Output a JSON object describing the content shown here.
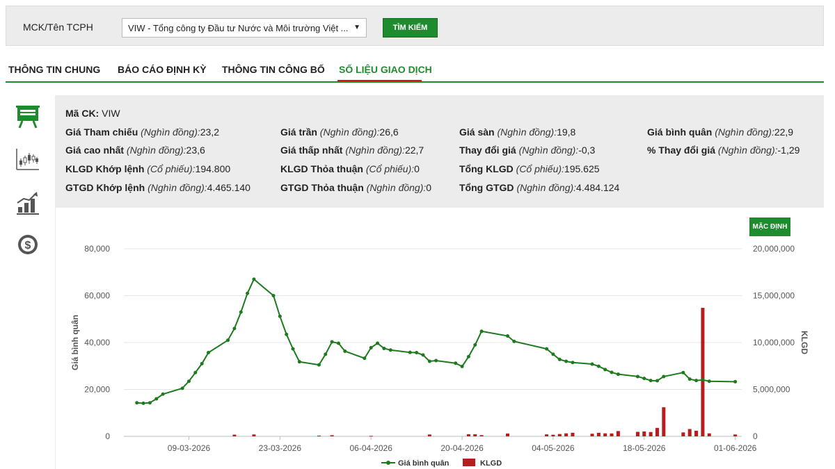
{
  "search": {
    "label": "MCK/Tên TCPH",
    "selected": "VIW - Tổng công ty Đầu tư Nước và Môi trường Việt ...",
    "button": "TÌM KIẾM"
  },
  "tabs": [
    {
      "label": "THÔNG TIN CHUNG"
    },
    {
      "label": "BÁO CÁO ĐỊNH KỲ"
    },
    {
      "label": "THÔNG TIN CÔNG BỐ"
    },
    {
      "label": "SỐ LIỆU GIAO DỊCH",
      "active": true
    }
  ],
  "sidebar": {
    "icons": [
      "presentation-icon",
      "candlestick-icon",
      "bar-growth-icon",
      "dollar-icon"
    ]
  },
  "info": {
    "ma_ck": {
      "label": "Mã CK:",
      "value": "VIW"
    },
    "rows": [
      [
        {
          "label": "Giá Tham chiếu",
          "unit": "(Nghìn đồng):",
          "value": "23,2"
        },
        {
          "label": "Giá trần",
          "unit": "(Nghìn đồng):",
          "value": "26,6"
        },
        {
          "label": "Giá sàn",
          "unit": "(Nghìn đồng):",
          "value": "19,8"
        },
        {
          "label": "Giá bình quân",
          "unit": "(Nghìn đồng):",
          "value": "22,9"
        }
      ],
      [
        {
          "label": "Giá cao nhất",
          "unit": "(Nghìn đồng):",
          "value": "23,6"
        },
        {
          "label": "Giá thấp nhất",
          "unit": "(Nghìn đồng):",
          "value": "22,7"
        },
        {
          "label": "Thay đổi giá",
          "unit": "(Nghìn đồng):",
          "value": "-0,3"
        },
        {
          "label": "% Thay đổi giá",
          "unit": "(Nghìn đồng):",
          "value": "-1,29"
        }
      ],
      [
        {
          "label": "KLGD Khớp lệnh",
          "unit": "(Cổ phiếu):",
          "value": "194.800"
        },
        {
          "label": "KLGD Thỏa thuận",
          "unit": "(Cổ phiếu):",
          "value": "0"
        },
        {
          "label": "Tổng KLGD",
          "unit": "(Cổ phiếu):",
          "value": "195.625"
        }
      ],
      [
        {
          "label": "GTGD Khớp lệnh",
          "unit": "(Nghìn đồng):",
          "value": "4.465.140"
        },
        {
          "label": "GTGD Thỏa thuận",
          "unit": "(Nghìn đồng):",
          "value": "0"
        },
        {
          "label": "Tổng GTGD",
          "unit": "(Nghìn đồng):",
          "value": "4.484.124"
        }
      ]
    ]
  },
  "chart": {
    "default_button": "MẶC ĐỊNH"
  },
  "chart_data": {
    "type": "line",
    "ylabel": "Giá bình quân",
    "y2label": "KLGD",
    "ylim": [
      0,
      80000
    ],
    "y2lim": [
      0,
      20000000
    ],
    "yticks": [
      "80,000",
      "60,000",
      "40,000",
      "20,000",
      "0"
    ],
    "y2ticks": [
      "20,000,000",
      "15,000,000",
      "10,000,000",
      "5,000,000",
      "0"
    ],
    "xticks": [
      "09-03-2026",
      "23-03-2026",
      "06-04-2026",
      "20-04-2026",
      "04-05-2026",
      "18-05-2026",
      "01-06-2026"
    ],
    "legend": [
      {
        "name": "Giá bình quân",
        "color": "#1e7a1e"
      },
      {
        "name": "KLGD",
        "color": "#b81c1c"
      }
    ],
    "grid": true,
    "line_color": "#1e7a1e",
    "bar_color": "#b81c1c",
    "series": [
      {
        "name": "Giá bình quân",
        "axis": "left",
        "points": [
          [
            "2026-03-01",
            14300
          ],
          [
            "2026-03-02",
            14100
          ],
          [
            "2026-03-03",
            14300
          ],
          [
            "2026-03-04",
            16000
          ],
          [
            "2026-03-05",
            18000
          ],
          [
            "2026-03-08",
            20500
          ],
          [
            "2026-03-09",
            23500
          ],
          [
            "2026-03-10",
            27200
          ],
          [
            "2026-03-11",
            31000
          ],
          [
            "2026-03-12",
            35700
          ],
          [
            "2026-03-15",
            41000
          ],
          [
            "2026-03-16",
            46000
          ],
          [
            "2026-03-17",
            53000
          ],
          [
            "2026-03-18",
            61000
          ],
          [
            "2026-03-19",
            67000
          ],
          [
            "2026-03-22",
            60000
          ],
          [
            "2026-03-23",
            51200
          ],
          [
            "2026-03-24",
            43500
          ],
          [
            "2026-03-25",
            37300
          ],
          [
            "2026-03-26",
            31800
          ],
          [
            "2026-03-29",
            30500
          ],
          [
            "2026-03-30",
            35000
          ],
          [
            "2026-03-31",
            40300
          ],
          [
            "2026-04-01",
            39700
          ],
          [
            "2026-04-02",
            36300
          ],
          [
            "2026-04-05",
            33300
          ],
          [
            "2026-04-06",
            37800
          ],
          [
            "2026-04-07",
            39700
          ],
          [
            "2026-04-08",
            37500
          ],
          [
            "2026-04-09",
            36800
          ],
          [
            "2026-04-12",
            35800
          ],
          [
            "2026-04-13",
            35700
          ],
          [
            "2026-04-14",
            34700
          ],
          [
            "2026-04-15",
            32000
          ],
          [
            "2026-04-16",
            32300
          ],
          [
            "2026-04-19",
            31200
          ],
          [
            "2026-04-20",
            29800
          ],
          [
            "2026-04-21",
            34000
          ],
          [
            "2026-04-22",
            39000
          ],
          [
            "2026-04-23",
            44800
          ],
          [
            "2026-04-27",
            42800
          ],
          [
            "2026-04-28",
            40500
          ],
          [
            "2026-05-03",
            37300
          ],
          [
            "2026-05-04",
            35000
          ],
          [
            "2026-05-05",
            32800
          ],
          [
            "2026-05-06",
            32000
          ],
          [
            "2026-05-07",
            31500
          ],
          [
            "2026-05-10",
            30800
          ],
          [
            "2026-05-11",
            29900
          ],
          [
            "2026-05-12",
            28500
          ],
          [
            "2026-05-13",
            27300
          ],
          [
            "2026-05-14",
            26500
          ],
          [
            "2026-05-17",
            25500
          ],
          [
            "2026-05-18",
            24700
          ],
          [
            "2026-05-19",
            23800
          ],
          [
            "2026-05-20",
            23700
          ],
          [
            "2026-05-21",
            25500
          ],
          [
            "2026-05-24",
            27200
          ],
          [
            "2026-05-25",
            24400
          ],
          [
            "2026-05-26",
            23800
          ],
          [
            "2026-05-27",
            24100
          ],
          [
            "2026-05-28",
            23500
          ],
          [
            "2026-06-01",
            23300
          ]
        ]
      },
      {
        "name": "KLGD",
        "axis": "right",
        "type": "bar",
        "points": [
          [
            "2026-03-16",
            180000
          ],
          [
            "2026-03-19",
            200000
          ],
          [
            "2026-03-29",
            80000
          ],
          [
            "2026-03-31",
            120000
          ],
          [
            "2026-04-06",
            50000
          ],
          [
            "2026-04-15",
            200000
          ],
          [
            "2026-04-21",
            230000
          ],
          [
            "2026-04-22",
            220000
          ],
          [
            "2026-04-23",
            130000
          ],
          [
            "2026-04-27",
            300000
          ],
          [
            "2026-05-03",
            210000
          ],
          [
            "2026-05-04",
            170000
          ],
          [
            "2026-05-05",
            250000
          ],
          [
            "2026-05-06",
            320000
          ],
          [
            "2026-05-07",
            380000
          ],
          [
            "2026-05-10",
            280000
          ],
          [
            "2026-05-11",
            380000
          ],
          [
            "2026-05-12",
            320000
          ],
          [
            "2026-05-13",
            310000
          ],
          [
            "2026-05-14",
            560000
          ],
          [
            "2026-05-17",
            480000
          ],
          [
            "2026-05-18",
            520000
          ],
          [
            "2026-05-19",
            460000
          ],
          [
            "2026-05-20",
            900000
          ],
          [
            "2026-05-21",
            3100000
          ],
          [
            "2026-05-24",
            420000
          ],
          [
            "2026-05-25",
            780000
          ],
          [
            "2026-05-26",
            600000
          ],
          [
            "2026-05-27",
            13700000
          ],
          [
            "2026-05-28",
            320000
          ],
          [
            "2026-06-01",
            195625
          ]
        ]
      }
    ]
  }
}
